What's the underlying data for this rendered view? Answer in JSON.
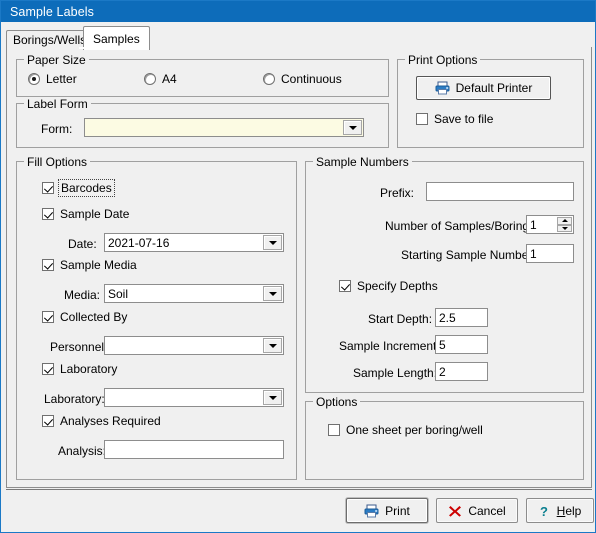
{
  "window": {
    "title": "Sample Labels",
    "accent_color": "#0d6cba"
  },
  "tabs": [
    {
      "label": "Borings/Wells",
      "active": false
    },
    {
      "label": "Samples",
      "active": true
    }
  ],
  "paper_size": {
    "caption": "Paper Size",
    "options": [
      {
        "label": "Letter",
        "selected": true
      },
      {
        "label": "A4",
        "selected": false
      },
      {
        "label": "Continuous",
        "selected": false
      }
    ]
  },
  "label_form": {
    "caption": "Label Form",
    "form_label": "Form:",
    "form_value": "",
    "form_bg": "#fcfbe3"
  },
  "print_options": {
    "caption": "Print Options",
    "default_printer_label": "Default Printer",
    "save_to_file_label": "Save to file",
    "save_to_file_checked": false
  },
  "fill_options": {
    "caption": "Fill Options",
    "barcodes_label": "Barcodes",
    "barcodes_checked": true,
    "sample_date_label": "Sample Date",
    "sample_date_checked": true,
    "date_label": "Date:",
    "date_value": "2021-07-16",
    "sample_media_label": "Sample Media",
    "sample_media_checked": true,
    "media_label": "Media:",
    "media_value": "Soil",
    "collected_by_label": "Collected By",
    "collected_by_checked": true,
    "personnel_label": "Personnel:",
    "personnel_value": "",
    "laboratory_check_label": "Laboratory",
    "laboratory_checked": true,
    "laboratory_label": "Laboratory:",
    "laboratory_value": "",
    "analyses_required_label": "Analyses Required",
    "analyses_required_checked": true,
    "analysis_label": "Analysis:",
    "analysis_value": ""
  },
  "sample_numbers": {
    "caption": "Sample Numbers",
    "prefix_label": "Prefix:",
    "prefix_value": "",
    "num_samples_label": "Number of Samples/Boring:",
    "num_samples_value": "1",
    "starting_number_label": "Starting Sample Number:",
    "starting_number_value": "1",
    "specify_depths_label": "Specify Depths",
    "specify_depths_checked": true,
    "start_depth_label": "Start Depth:",
    "start_depth_value": "2.5",
    "sample_increment_label": "Sample Increment:",
    "sample_increment_value": "5",
    "sample_length_label": "Sample Length:",
    "sample_length_value": "2"
  },
  "options": {
    "caption": "Options",
    "one_sheet_label": "One sheet per boring/well",
    "one_sheet_checked": false
  },
  "footer": {
    "print_label": "Print",
    "cancel_label": "Cancel",
    "help_label_pre": "H",
    "help_label_post": "elp"
  }
}
